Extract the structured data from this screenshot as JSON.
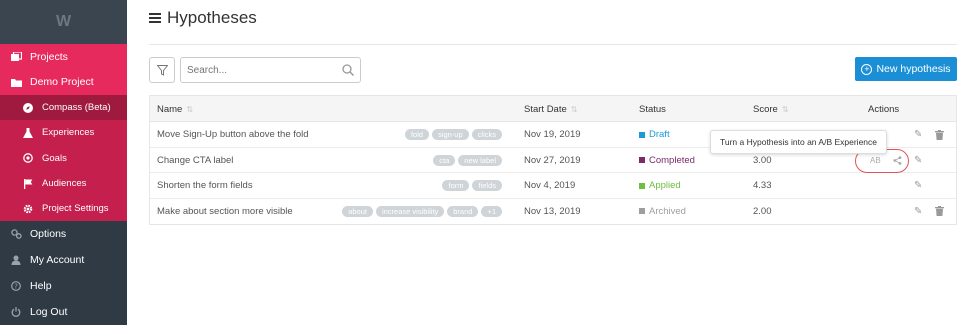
{
  "sidebar": {
    "logo": "W",
    "items": [
      {
        "label": "Projects",
        "icon": "folders-icon"
      },
      {
        "label": "Demo Project",
        "icon": "folder-icon"
      }
    ],
    "sub_items": [
      {
        "label": "Compass (Beta)",
        "icon": "compass-icon",
        "active": true
      },
      {
        "label": "Experiences",
        "icon": "flask-icon"
      },
      {
        "label": "Goals",
        "icon": "target-icon"
      },
      {
        "label": "Audiences",
        "icon": "flag-icon"
      },
      {
        "label": "Project Settings",
        "icon": "gear-icon"
      }
    ],
    "bottom_items": [
      {
        "label": "Options",
        "icon": "gears-icon"
      },
      {
        "label": "My Account",
        "icon": "user-icon"
      },
      {
        "label": "Help",
        "icon": "help-icon"
      },
      {
        "label": "Log Out",
        "icon": "power-icon"
      }
    ]
  },
  "header": {
    "title": "Hypotheses"
  },
  "search": {
    "placeholder": "Search..."
  },
  "new_button": {
    "label": "New hypothesis"
  },
  "table": {
    "columns": {
      "name": "Name",
      "start_date": "Start Date",
      "status": "Status",
      "score": "Score",
      "actions": "Actions"
    },
    "rows": [
      {
        "name": "Move Sign-Up button above the fold",
        "tags": [
          "fold",
          "sign-up",
          "clicks"
        ],
        "date": "Nov 19, 2019",
        "status": "Draft",
        "status_color": "#1a9ad6",
        "score": ""
      },
      {
        "name": "Change CTA label",
        "tags": [
          "cta",
          "new label"
        ],
        "date": "Nov 27, 2019",
        "status": "Completed",
        "status_color": "#7b2a6b",
        "score": "3.00"
      },
      {
        "name": "Shorten the form fields",
        "tags": [
          "form",
          "fields"
        ],
        "date": "Nov 4, 2019",
        "status": "Applied",
        "status_color": "#6cbf3f",
        "score": "4.33"
      },
      {
        "name": "Make about section more visible",
        "tags": [
          "about",
          "increase visibility",
          "brand",
          "+1"
        ],
        "date": "Nov 13, 2019",
        "status": "Archived",
        "status_color": "#9e9e9e",
        "score": "2.00"
      }
    ]
  },
  "tooltip": {
    "text": "Turn a Hypothesis into an A/B Experience"
  },
  "ab_label": "AB",
  "colors": {
    "accent": "#e72a5e",
    "sidebar": "#2f3a44",
    "primary_button": "#1a8fd6"
  }
}
